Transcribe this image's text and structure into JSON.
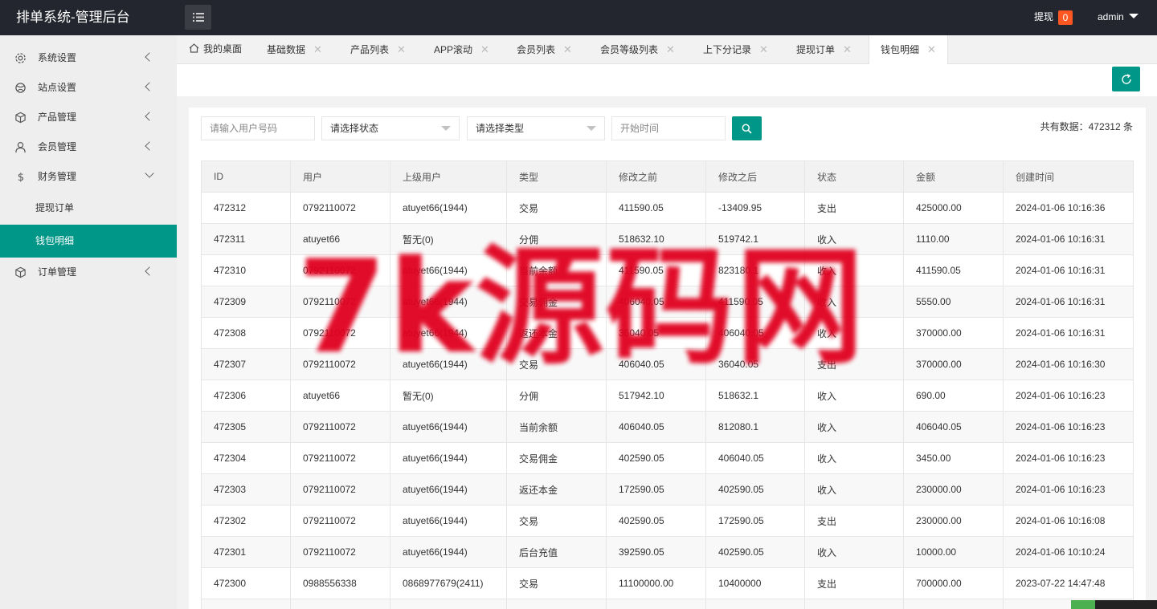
{
  "app": {
    "title": "排单系统-管理后台"
  },
  "header": {
    "withdraw_label": "提现",
    "withdraw_count": "0",
    "user": "admin"
  },
  "sidebar": {
    "items": [
      {
        "label": "系统设置",
        "icon": "gear-icon"
      },
      {
        "label": "站点设置",
        "icon": "globe-icon"
      },
      {
        "label": "产品管理",
        "icon": "box-icon"
      },
      {
        "label": "会员管理",
        "icon": "user-icon"
      },
      {
        "label": "财务管理",
        "icon": "dollar-icon"
      },
      {
        "label": "订单管理",
        "icon": "box-icon"
      }
    ],
    "sub_items": [
      {
        "label": "提现订单"
      },
      {
        "label": "钱包明细"
      }
    ]
  },
  "tabs": [
    {
      "label": "我的桌面"
    },
    {
      "label": "基础数据"
    },
    {
      "label": "产品列表"
    },
    {
      "label": "APP滚动"
    },
    {
      "label": "会员列表"
    },
    {
      "label": "会员等级列表"
    },
    {
      "label": "上下分记录"
    },
    {
      "label": "提现订单"
    },
    {
      "label": "钱包明细"
    }
  ],
  "filters": {
    "user_placeholder": "请输入用户号码",
    "status_select": "请选择状态",
    "type_select": "请选择类型",
    "time_placeholder": "开始时间"
  },
  "total_label": "共有数据：472312 条",
  "table": {
    "headers": [
      "ID",
      "用户",
      "上级用户",
      "类型",
      "修改之前",
      "修改之后",
      "状态",
      "金额",
      "创建时间"
    ],
    "rows": [
      [
        "472312",
        "0792110072",
        "atuyet66(1944)",
        "交易",
        "411590.05",
        "-13409.95",
        "支出",
        "425000.00",
        "2024-01-06 10:16:36"
      ],
      [
        "472311",
        "atuyet66",
        "暂无(0)",
        "分佣",
        "518632.10",
        "519742.1",
        "收入",
        "1110.00",
        "2024-01-06 10:16:31"
      ],
      [
        "472310",
        "0792110072",
        "atuyet66(1944)",
        "当前余额",
        "411590.05",
        "823180.1",
        "收入",
        "411590.05",
        "2024-01-06 10:16:31"
      ],
      [
        "472309",
        "0792110072",
        "atuyet66(1944)",
        "交易佣金",
        "406040.05",
        "411590.05",
        "收入",
        "5550.00",
        "2024-01-06 10:16:31"
      ],
      [
        "472308",
        "0792110072",
        "atuyet66(1944)",
        "返还本金",
        "36040.05",
        "406040.05",
        "收入",
        "370000.00",
        "2024-01-06 10:16:31"
      ],
      [
        "472307",
        "0792110072",
        "atuyet66(1944)",
        "交易",
        "406040.05",
        "36040.05",
        "支出",
        "370000.00",
        "2024-01-06 10:16:30"
      ],
      [
        "472306",
        "atuyet66",
        "暂无(0)",
        "分佣",
        "517942.10",
        "518632.1",
        "收入",
        "690.00",
        "2024-01-06 10:16:23"
      ],
      [
        "472305",
        "0792110072",
        "atuyet66(1944)",
        "当前余额",
        "406040.05",
        "812080.1",
        "收入",
        "406040.05",
        "2024-01-06 10:16:23"
      ],
      [
        "472304",
        "0792110072",
        "atuyet66(1944)",
        "交易佣金",
        "402590.05",
        "406040.05",
        "收入",
        "3450.00",
        "2024-01-06 10:16:23"
      ],
      [
        "472303",
        "0792110072",
        "atuyet66(1944)",
        "返还本金",
        "172590.05",
        "402590.05",
        "收入",
        "230000.00",
        "2024-01-06 10:16:23"
      ],
      [
        "472302",
        "0792110072",
        "atuyet66(1944)",
        "交易",
        "402590.05",
        "172590.05",
        "支出",
        "230000.00",
        "2024-01-06 10:16:08"
      ],
      [
        "472301",
        "0792110072",
        "atuyet66(1944)",
        "后台充值",
        "392590.05",
        "402590.05",
        "收入",
        "10000.00",
        "2024-01-06 10:10:24"
      ],
      [
        "472300",
        "0988556338",
        "0868977679(2411)",
        "交易",
        "11100000.00",
        "10400000",
        "支出",
        "700000.00",
        "2023-07-22 14:47:48"
      ],
      [
        "",
        "",
        "",
        "",
        "",
        "",
        "",
        "",
        ""
      ]
    ]
  },
  "watermark": "7k源码网",
  "colors": {
    "accent": "#009688",
    "topbar": "#23262e",
    "badge": "#ff5722",
    "watermark": "#e0001e"
  }
}
